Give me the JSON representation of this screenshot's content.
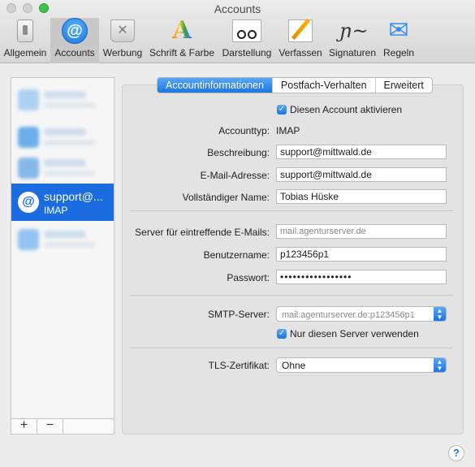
{
  "window": {
    "title": "Accounts"
  },
  "toolbar": {
    "items": [
      {
        "label": "Allgemein",
        "icon": "general-switch-icon"
      },
      {
        "label": "Accounts",
        "icon": "at-sign-icon",
        "glyph": "@"
      },
      {
        "label": "Werbung",
        "icon": "junk-trash-icon",
        "glyph": "✕"
      },
      {
        "label": "Schrift & Farbe",
        "icon": "font-color-icon",
        "glyph": "A"
      },
      {
        "label": "Darstellung",
        "icon": "glasses-icon"
      },
      {
        "label": "Verfassen",
        "icon": "pencil-icon"
      },
      {
        "label": "Signaturen",
        "icon": "signature-icon",
        "glyph": "ɲ~"
      },
      {
        "label": "Regeln",
        "icon": "rules-arrows-icon",
        "glyph": "✉"
      }
    ]
  },
  "sidebar": {
    "selected": {
      "name": "support@...",
      "type": "IMAP",
      "glyph": "@"
    },
    "add_label": "+",
    "remove_label": "−"
  },
  "tabs": [
    {
      "label": "Accountinformationen"
    },
    {
      "label": "Postfach-Verhalten"
    },
    {
      "label": "Erweitert"
    }
  ],
  "form": {
    "enable_label": "Account aktivieren",
    "enable_prefix": "Diesen",
    "accounttype_label": "Accounttyp:",
    "accounttype_value": "IMAP",
    "beschreibung_label": "Beschreibung:",
    "beschreibung_value": "support@mittwald.de",
    "email_label": "E-Mail-Adresse:",
    "email_value": "support@mittwald.de",
    "name_label": "Vollständiger Name:",
    "name_value": "Tobias Hüske",
    "incoming_label": "Server für eintreffende E-Mails:",
    "incoming_value": "mail.agenturserver.de",
    "user_label": "Benutzername:",
    "user_value": "p123456p1",
    "pass_label": "Passwort:",
    "pass_value": "•••••••••••••••••",
    "smtp_label": "SMTP-Server:",
    "smtp_value": "mail.agenturserver.de:p123456p1",
    "only_server_label": "Nur diesen Server verwenden",
    "tls_label": "TLS-Zertifikat:",
    "tls_value": "Ohne"
  },
  "help": {
    "glyph": "?"
  },
  "colors": {
    "accent": "#1a6ce0"
  }
}
